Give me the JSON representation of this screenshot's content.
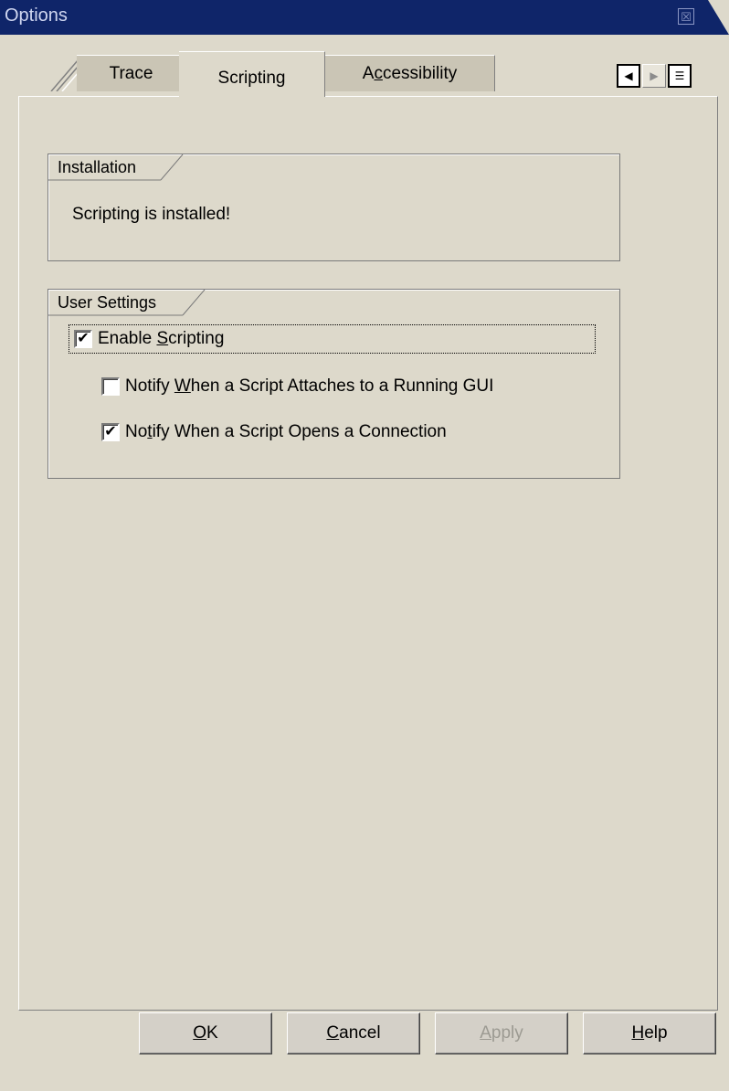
{
  "window": {
    "title": "Options",
    "close_glyph": "☒"
  },
  "tabs": [
    {
      "label_pre": "",
      "label_ul": "",
      "label_post": "Trace",
      "active": false
    },
    {
      "label_pre": "",
      "label_ul": "",
      "label_post": "Scripting",
      "active": true
    },
    {
      "label_pre": "A",
      "label_ul": "c",
      "label_post": "cessibility",
      "active": false
    }
  ],
  "tab_scroll": {
    "left_icon": "scroll-left-icon",
    "right_icon": "scroll-right-icon",
    "list_icon": "tab-list-icon"
  },
  "installation": {
    "title": "Installation",
    "status_text": "Scripting is installed!"
  },
  "user_settings": {
    "title": "User Settings",
    "enable_scripting": {
      "pre": "Enable ",
      "ul": "S",
      "post": "cripting",
      "checked": true
    },
    "notify_attach": {
      "pre": "Notify ",
      "ul": "W",
      "post": "hen a Script Attaches to a Running GUI",
      "checked": false
    },
    "notify_connection": {
      "pre": "No",
      "ul": "t",
      "post": "ify When a Script Opens a Connection",
      "checked": true
    }
  },
  "buttons": {
    "ok": {
      "ul": "O",
      "post": "K"
    },
    "cancel": {
      "ul": "C",
      "post": "ancel"
    },
    "apply": {
      "ul": "A",
      "post": "pply",
      "disabled": true
    },
    "help": {
      "ul": "H",
      "post": "elp"
    }
  },
  "colors": {
    "titlebar": "#0f2569",
    "dialog_bg": "#ddd9cb"
  }
}
